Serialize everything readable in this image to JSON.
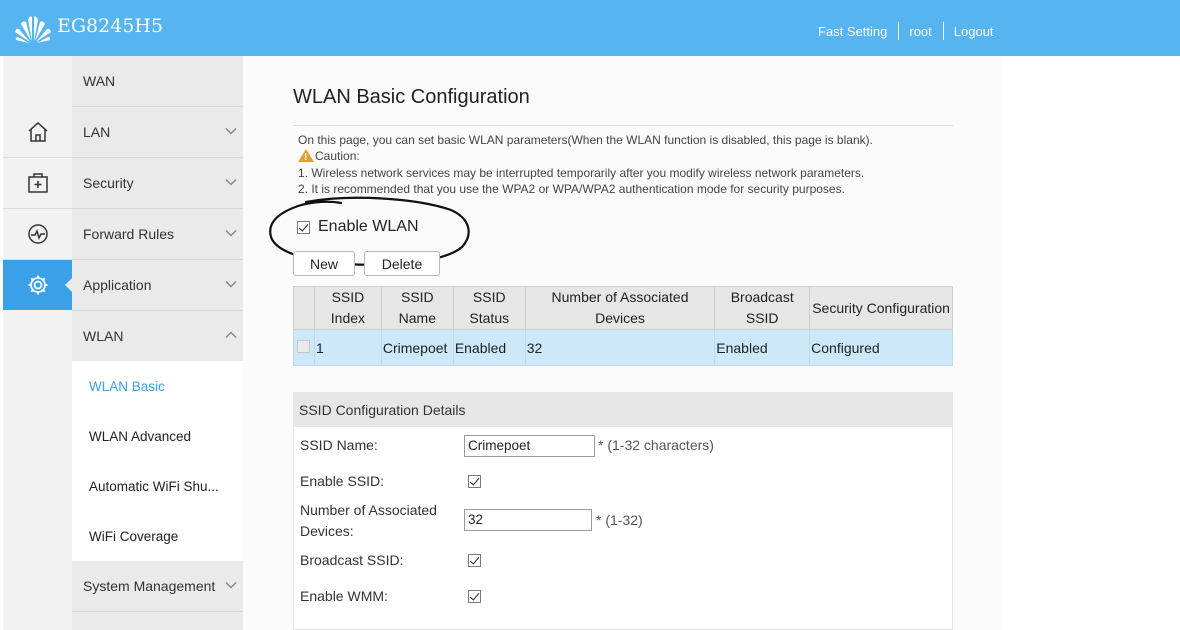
{
  "header": {
    "product_name": "EG8245H5",
    "links": [
      "Fast Setting",
      "root",
      "Logout"
    ]
  },
  "sidebar": {
    "icons": [
      "home-icon",
      "add-box-icon",
      "monitor-icon",
      "gear-icon"
    ],
    "menu": [
      {
        "label": "WAN"
      },
      {
        "label": "LAN"
      },
      {
        "label": "Security"
      },
      {
        "label": "Forward Rules"
      },
      {
        "label": "Application"
      },
      {
        "label": "WLAN"
      }
    ],
    "submenu": [
      {
        "label": "WLAN Basic",
        "selected": true
      },
      {
        "label": "WLAN Advanced"
      },
      {
        "label": "Automatic WiFi Shu..."
      },
      {
        "label": "WiFi Coverage"
      }
    ],
    "footer_menu": {
      "label": "System Management"
    }
  },
  "page": {
    "title": "WLAN Basic Configuration",
    "notes": {
      "intro": "On this page, you can set basic WLAN parameters(When the WLAN function is disabled, this page is blank).",
      "caution": "Caution:",
      "line1": "1. Wireless network services may be interrupted temporarily after you modify wireless network parameters.",
      "line2": "2. It is recommended that you use the WPA2 or WPA/WPA2 authentication mode for security purposes."
    },
    "enable_wlan": {
      "label": "Enable WLAN",
      "checked": true
    },
    "buttons": {
      "new": "New",
      "delete": "Delete"
    }
  },
  "ssid_table": {
    "headers": [
      "SSID Index",
      "SSID Name",
      "SSID Status",
      "Number of Associated Devices",
      "Broadcast SSID",
      "Security Configuration"
    ],
    "rows": [
      {
        "index": "1",
        "name": "Crimepoet",
        "status": "Enabled",
        "devices": "32",
        "broadcast": "Enabled",
        "security": "Configured"
      }
    ]
  },
  "ssid_config": {
    "title": "SSID Configuration Details",
    "ssid_name": {
      "label": "SSID Name:",
      "value": "Crimepoet",
      "hint": "* (1-32 characters)"
    },
    "enable_ssid": {
      "label": "Enable SSID:",
      "checked": true
    },
    "assoc_devices": {
      "label": "Number of Associated Devices:",
      "value": "32",
      "hint": "* (1-32)"
    },
    "broadcast_ssid": {
      "label": "Broadcast SSID:",
      "checked": true
    },
    "enable_wmm": {
      "label": "Enable WMM:",
      "checked": true
    }
  },
  "colors": {
    "accent": "#56b4f0",
    "selected_row": "#cde8f9",
    "active_icon": "#3aa0e8"
  }
}
